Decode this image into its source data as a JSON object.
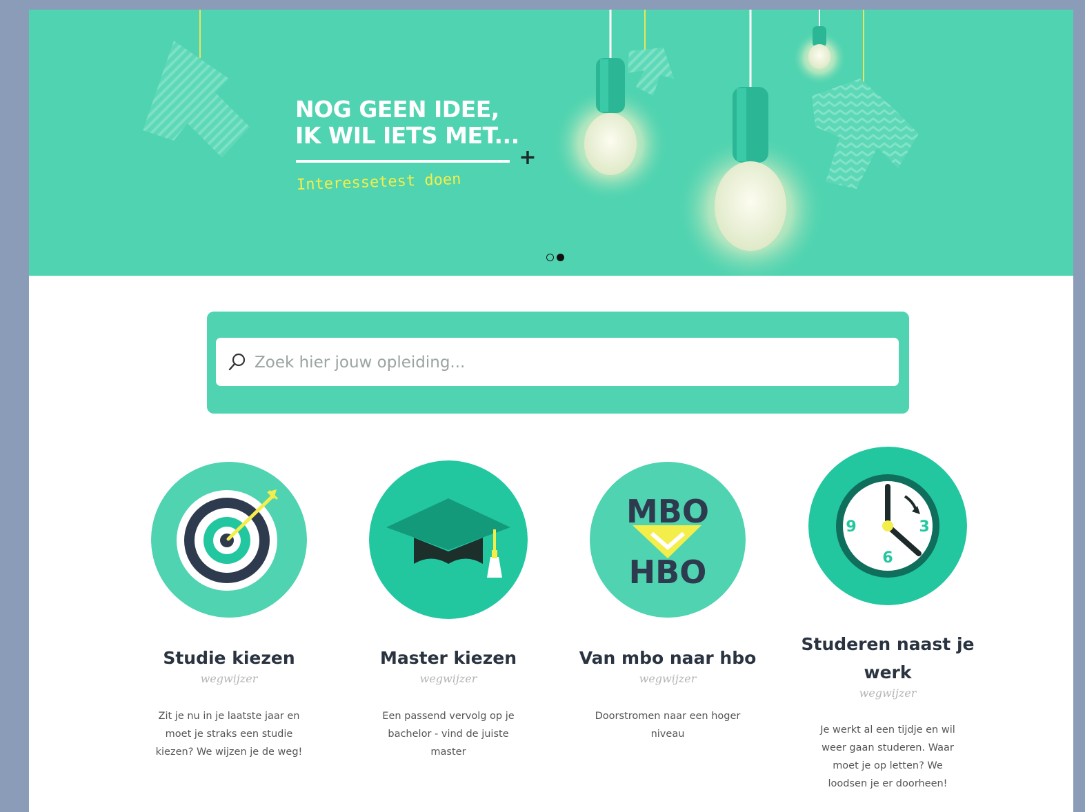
{
  "hero": {
    "headline_line1": "NOG GEEN IDEE,",
    "headline_line2": "IK WIL IETS MET...",
    "plus": "+",
    "cta": "Interessetest doen",
    "slides": 2,
    "active_slide": 2
  },
  "search": {
    "placeholder": "Zoek hier jouw opleiding...",
    "value": ""
  },
  "cards": [
    {
      "title": "Studie kiezen",
      "subtitle": "wegwijzer",
      "description": "Zit je nu in je laatste jaar en moet je straks een studie kiezen? We wijzen je de weg!",
      "icon": "target-icon"
    },
    {
      "title": "Master kiezen",
      "subtitle": "wegwijzer",
      "description": "Een passend vervolg op je bachelor - vind de juiste master",
      "icon": "graduation-cap-icon"
    },
    {
      "title": "Van mbo naar hbo",
      "subtitle": "wegwijzer",
      "description": "Doorstromen naar een hoger niveau",
      "icon": "mbo-hbo-icon",
      "icon_text_top": "MBO",
      "icon_text_bottom": "HBO"
    },
    {
      "title_line1": "Studeren naast je",
      "title_line2": "werk",
      "subtitle": "wegwijzer",
      "description": "Je werkt al een tijdje en wil weer gaan studeren. Waar moet je op letten? We loodsen je er doorheen!",
      "icon": "clock-icon",
      "clock_labels": [
        "9",
        "3",
        "6"
      ]
    }
  ],
  "colors": {
    "accent": "#4fd3b0",
    "accent_dark": "#22c7a0",
    "dark": "#2e3a4e",
    "yellow": "#f4ee4a",
    "background": "#8a9cb8"
  }
}
